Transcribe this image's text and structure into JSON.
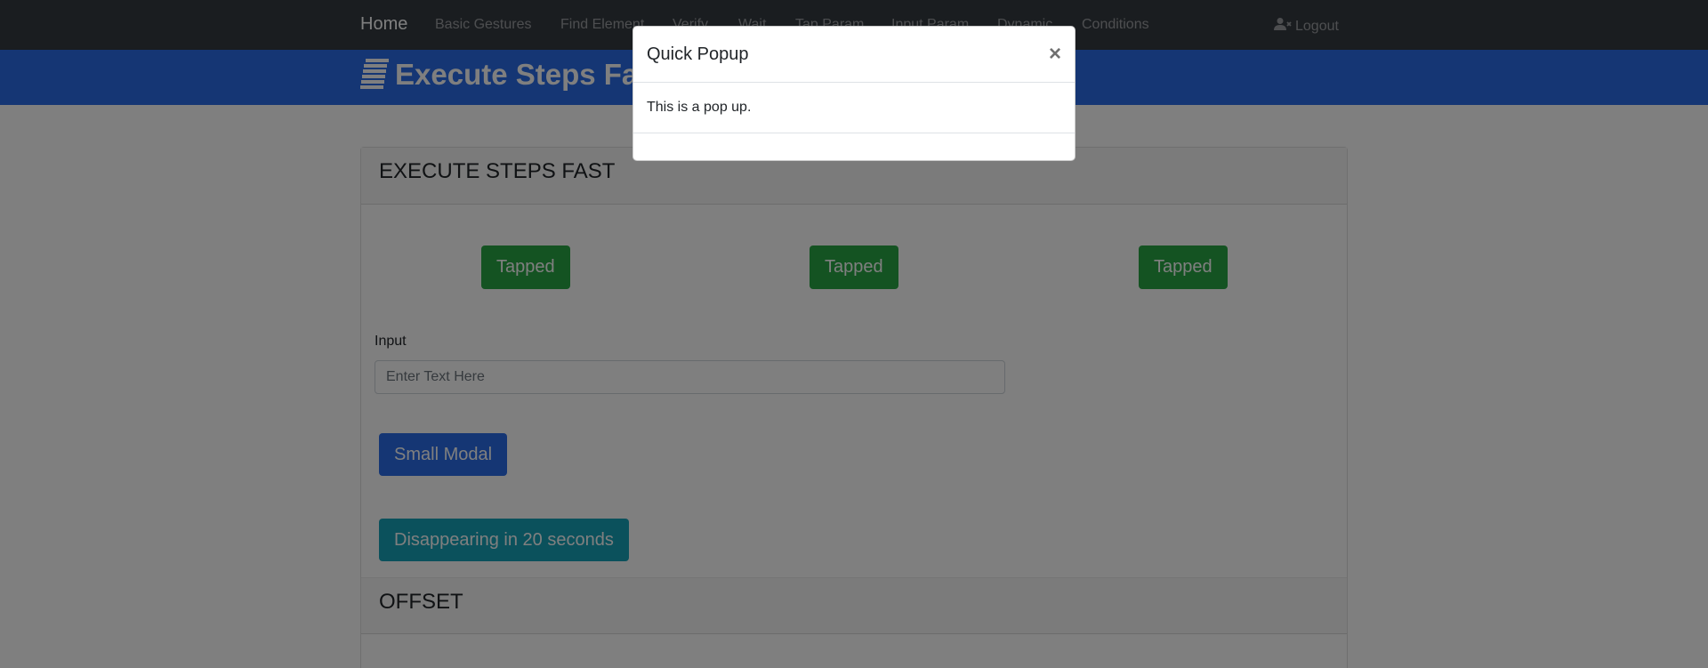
{
  "navbar": {
    "brand": "Home",
    "items": [
      {
        "label": "Basic Gestures"
      },
      {
        "label": "Find Element"
      },
      {
        "label": "Verify"
      },
      {
        "label": "Wait"
      },
      {
        "label": "Tap Param"
      },
      {
        "label": "Input Param"
      },
      {
        "label": "Dynamic"
      },
      {
        "label": "Conditions"
      }
    ],
    "logout": {
      "label": "Logout",
      "icon": "user-times-icon"
    }
  },
  "banner": {
    "title": "Execute Steps Fast",
    "icon": "stream-lines-icon",
    "color": "#2a6de8"
  },
  "card": {
    "title": "EXECUTE STEPS FAST",
    "tap_buttons": [
      {
        "label": "Tapped"
      },
      {
        "label": "Tapped"
      },
      {
        "label": "Tapped"
      }
    ],
    "input": {
      "label": "Input",
      "placeholder": "Enter Text Here",
      "value": ""
    },
    "small_modal_button": "Small Modal",
    "disappearing_button": "Disappearing in 20 seconds",
    "offset_title": "OFFSET"
  },
  "modal": {
    "title": "Quick Popup",
    "close": "×",
    "body": "This is a pop up."
  },
  "colors": {
    "navbar": "#343a40",
    "primary": "#2a6de8",
    "success": "#28a745",
    "info": "#17a2b8"
  }
}
